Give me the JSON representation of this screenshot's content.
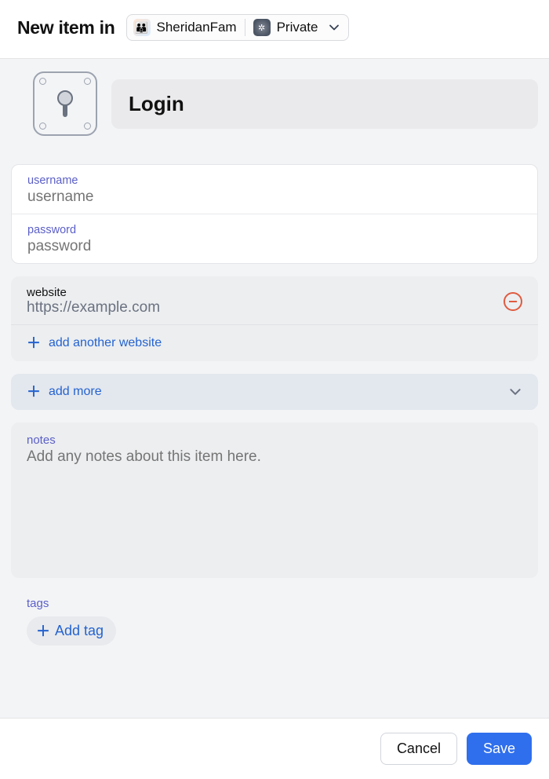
{
  "header": {
    "title": "New item in",
    "account_name": "SheridanFam",
    "vault_name": "Private"
  },
  "category": {
    "title": "Login"
  },
  "fields": {
    "username": {
      "label": "username",
      "placeholder": "username",
      "value": ""
    },
    "password": {
      "label": "password",
      "placeholder": "password",
      "value": ""
    }
  },
  "website": {
    "label": "website",
    "value": "https://example.com",
    "add_label": "add another website"
  },
  "add_more": {
    "label": "add more"
  },
  "notes": {
    "label": "notes",
    "placeholder": "Add any notes about this item here."
  },
  "tags": {
    "label": "tags",
    "add_label": "Add tag"
  },
  "footer": {
    "cancel": "Cancel",
    "save": "Save"
  }
}
